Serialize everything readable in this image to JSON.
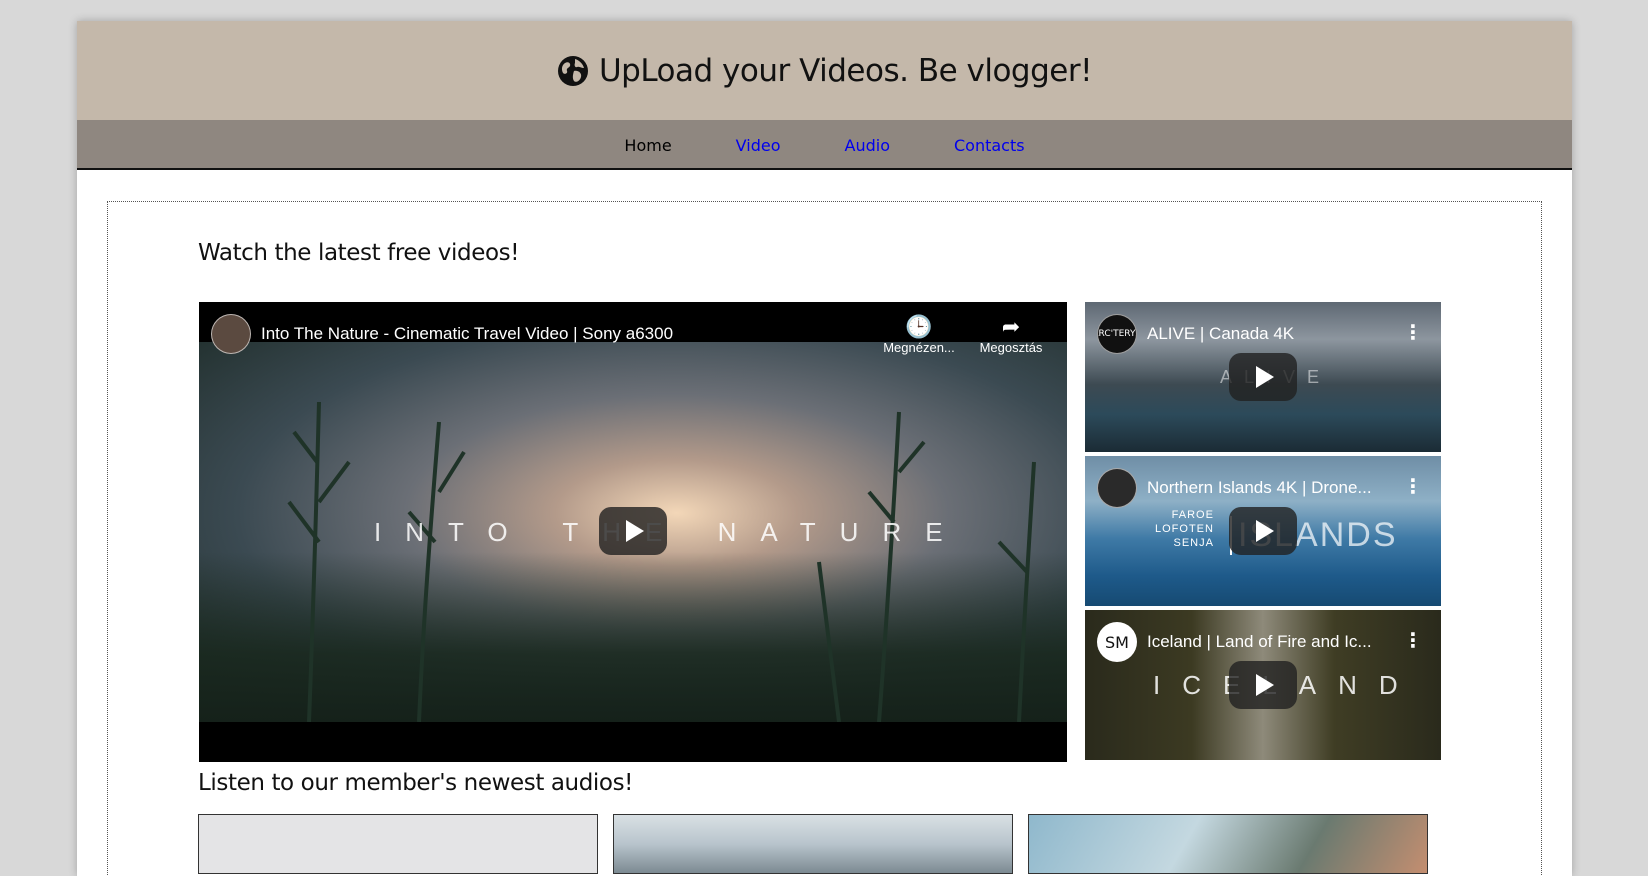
{
  "header": {
    "title": "UpLoad your Videos. Be vlogger!",
    "icon": "globe-icon"
  },
  "nav": {
    "items": [
      {
        "label": "Home"
      },
      {
        "label": "Video"
      },
      {
        "label": "Audio"
      },
      {
        "label": "Contacts"
      }
    ]
  },
  "videos_section": {
    "title": "Watch the latest free videos!"
  },
  "main_video": {
    "title": "Into The Nature - Cinematic Travel Video | Sony a6300",
    "overlay": "INTO THE NATURE",
    "watch_later_label": "Megnézen...",
    "share_label": "Megosztás"
  },
  "side_videos": [
    {
      "title": "ALIVE | Canada 4K",
      "channel": "ARC'TERYX",
      "overlay": "ALIVE"
    },
    {
      "title": "Northern Islands 4K | Drone...",
      "channel": "",
      "overlay": "ISLANDS",
      "overlay_sub": [
        "FAROE",
        "LOFOTEN",
        "SENJA"
      ]
    },
    {
      "title": "Iceland | Land of Fire and Ic...",
      "channel": "SM",
      "overlay": "ICELAND"
    }
  ],
  "audio_section": {
    "title": "Listen to our member's newest audios!"
  },
  "colors": {
    "header_bg": "#c4b8aa",
    "nav_bg": "#8f8780",
    "link": "#0000ee"
  }
}
